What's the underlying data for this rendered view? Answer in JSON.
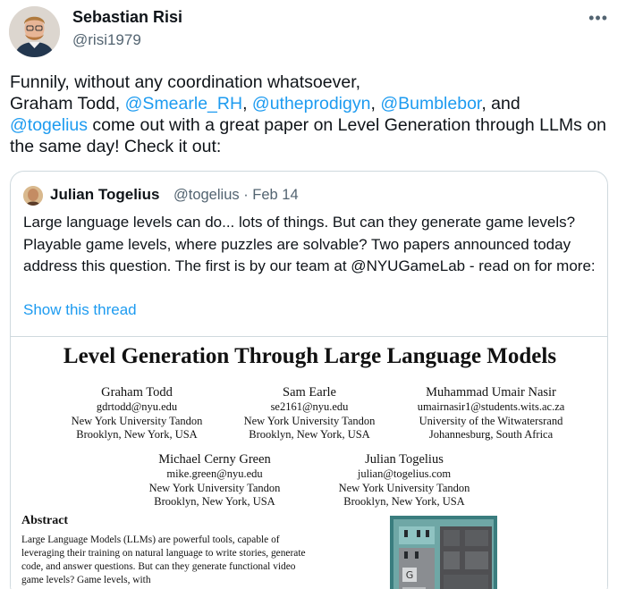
{
  "author": {
    "name": "Sebastian Risi",
    "handle": "@risi1979",
    "more_icon": "•••"
  },
  "tweet": {
    "t1": "Funnily, without any coordination whatsoever,",
    "t2": "Graham Todd, ",
    "m1": "@Smearle_RH",
    "t3": ", ",
    "m2": "@utheprodigyn",
    "t4": ", ",
    "m3": "@Bumblebor",
    "t5": ", and",
    "m4": "@togelius",
    "t6": " come out with a great paper on Level Generation through LLMs on the same day! Check it out:"
  },
  "quote": {
    "name": "Julian Togelius",
    "meta": "@togelius · Feb 14",
    "text": "Large language levels can do... lots of things. But can they generate game levels? Playable game levels, where puzzles are solvable? Two papers announced today address this question. The first is by our team at @NYUGameLab - read on for more:",
    "show_thread": "Show this thread"
  },
  "paper": {
    "title": "Level Generation Through Large Language Models",
    "authors": [
      {
        "name": "Graham Todd",
        "email": "gdrtodd@nyu.edu",
        "affil": "New York University Tandon",
        "loc": "Brooklyn, New York, USA"
      },
      {
        "name": "Sam Earle",
        "email": "se2161@nyu.edu",
        "affil": "New York University Tandon",
        "loc": "Brooklyn, New York, USA"
      },
      {
        "name": "Muhammad Umair Nasir",
        "email": "umairnasir1@students.wits.ac.za",
        "affil": "University of the Witwatersrand",
        "loc": "Johannesburg, South Africa"
      },
      {
        "name": "Michael Cerny Green",
        "email": "mike.green@nyu.edu",
        "affil": "New York University Tandon",
        "loc": "Brooklyn, New York, USA"
      },
      {
        "name": "Julian Togelius",
        "email": "julian@togelius.com",
        "affil": "New York University Tandon",
        "loc": "Brooklyn, New York, USA"
      }
    ],
    "abstract_heading": "Abstract",
    "abstract_text": "Large Language Models (LLMs) are powerful tools, capable of leveraging their training on natural language to write stories, generate code, and answer questions. But can they generate functional video game levels? Game levels, with"
  },
  "colors": {
    "link": "#1d9bf0",
    "muted": "#536471",
    "border": "#cfd9de"
  }
}
